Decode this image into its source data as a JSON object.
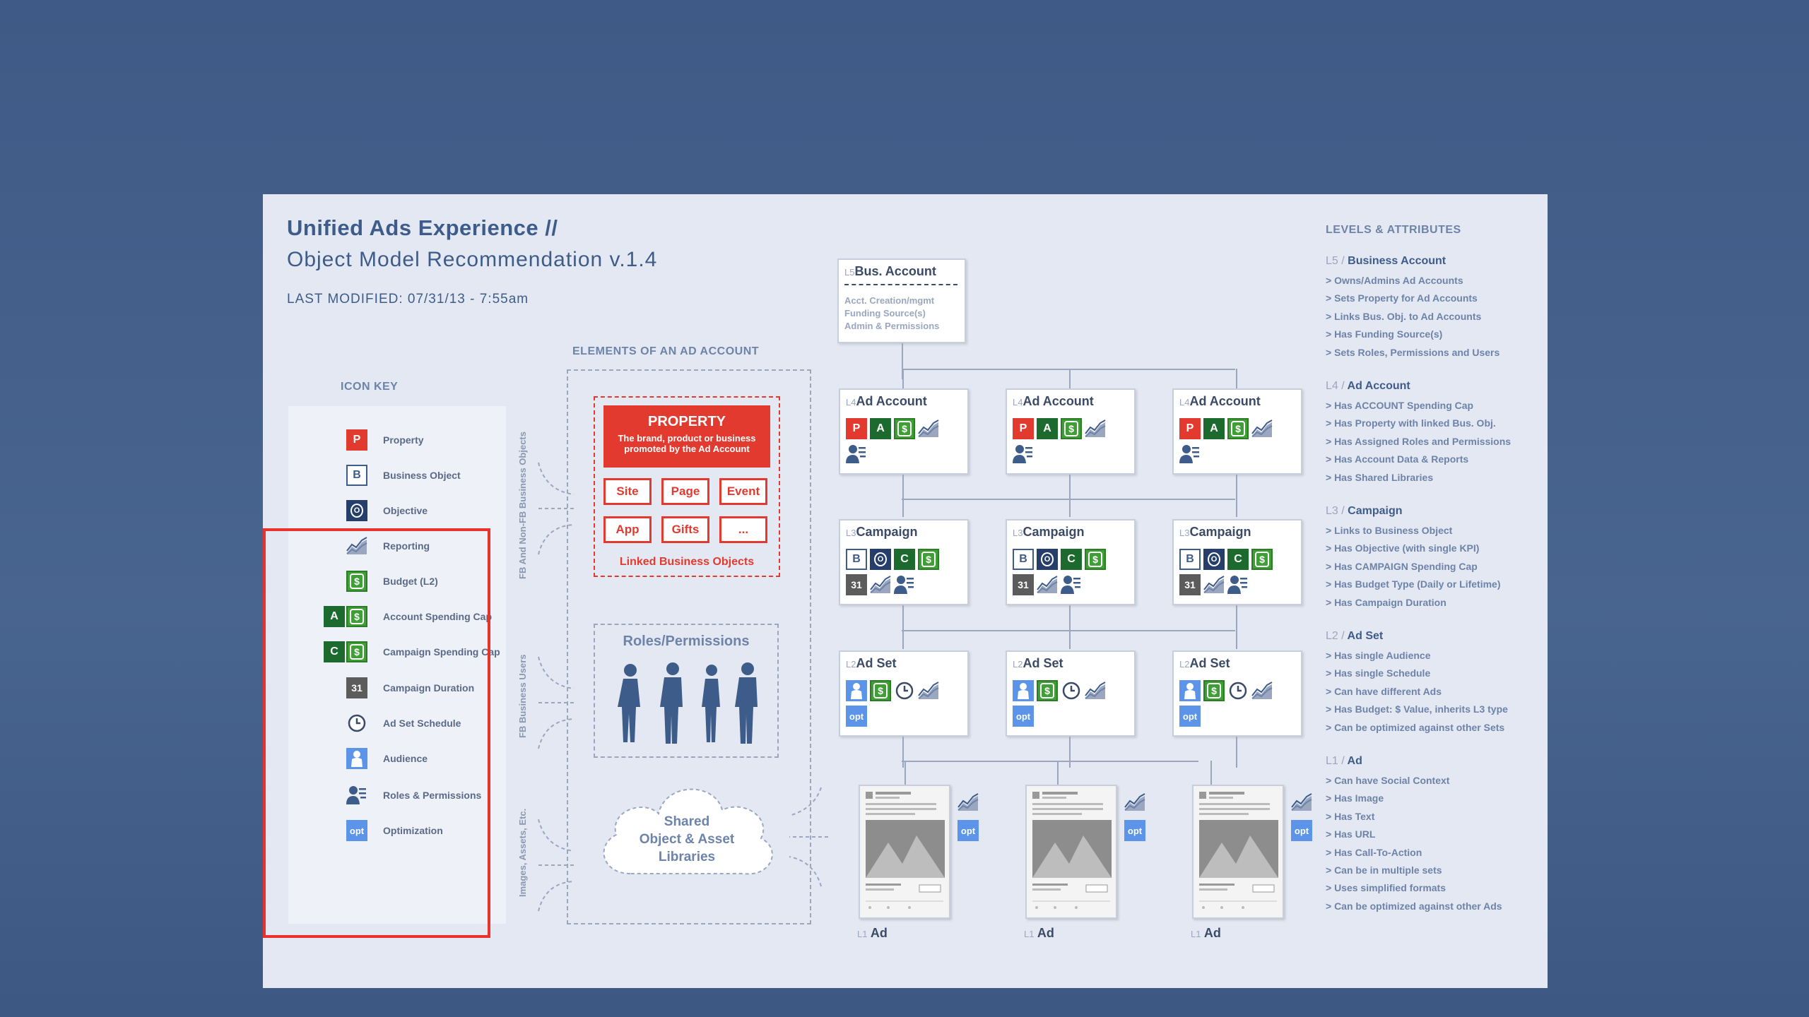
{
  "header": {
    "title": "Unified Ads Experience //",
    "subtitle": "Object Model Recommendation v.1.4",
    "modified": "LAST MODIFIED: 07/31/13 - 7:55am"
  },
  "icon_key": {
    "heading": "ICON KEY",
    "items": [
      {
        "label": "Property",
        "icons": [
          "P"
        ]
      },
      {
        "label": "Business Object",
        "icons": [
          "B"
        ]
      },
      {
        "label": "Objective",
        "icons": [
          "O"
        ]
      },
      {
        "label": "Reporting",
        "icons": [
          "reporting-icon"
        ]
      },
      {
        "label": "Budget (L2)",
        "icons": [
          "$"
        ]
      },
      {
        "label": "Account Spending Cap",
        "icons": [
          "A",
          "$"
        ]
      },
      {
        "label": "Campaign Spending Cap",
        "icons": [
          "C",
          "$"
        ]
      },
      {
        "label": "Campaign Duration",
        "icons": [
          "31"
        ]
      },
      {
        "label": "Ad Set Schedule",
        "icons": [
          "clock-icon"
        ]
      },
      {
        "label": "Audience",
        "icons": [
          "audience-icon"
        ]
      },
      {
        "label": "Roles & Permissions",
        "icons": [
          "roles-icon"
        ]
      },
      {
        "label": "Optimization",
        "icons": [
          "opt"
        ]
      }
    ]
  },
  "elements": {
    "heading": "ELEMENTS OF AN AD ACCOUNT",
    "property_title": "PROPERTY",
    "property_desc1": "The brand, product or business",
    "property_desc2": "promoted by the Ad Account",
    "buttons": [
      "Site",
      "Page",
      "Event",
      "App",
      "Gifts",
      "..."
    ],
    "linked_label": "Linked Business Objects",
    "roles_title": "Roles/Permissions",
    "library1": "Shared",
    "library2": "Object & Asset",
    "library3": "Libraries",
    "side_labels": [
      "FB And Non-FB Business Objects",
      "FB Business Users",
      "Images, Assets, Etc."
    ]
  },
  "tree": {
    "bus_account": {
      "level": "L5",
      "title": "Bus. Account",
      "lines": [
        "Acct. Creation/mgmt",
        "Funding Source(s)",
        "Admin & Permissions"
      ]
    },
    "ad_account": {
      "level": "L4",
      "title": "Ad Account"
    },
    "campaign": {
      "level": "L3",
      "title": "Campaign"
    },
    "ad_set": {
      "level": "L2",
      "title": "Ad Set"
    },
    "ad": {
      "level": "L1",
      "title": "Ad"
    },
    "opt": "opt",
    "cal": "31"
  },
  "attributes": {
    "heading": "LEVELS & ATTRIBUTES",
    "levels": [
      {
        "lv": "L5 /",
        "name": "Business Account",
        "items": [
          "> Owns/Admins Ad Accounts",
          "> Sets Property for Ad Accounts",
          "> Links Bus. Obj. to Ad Accounts",
          "> Has Funding Source(s)",
          "> Sets Roles, Permissions and Users"
        ]
      },
      {
        "lv": "L4 /",
        "name": "Ad Account",
        "items": [
          "> Has ACCOUNT Spending Cap",
          "> Has Property with linked Bus. Obj.",
          "> Has Assigned Roles and Permissions",
          "> Has Account Data & Reports",
          "> Has Shared Libraries"
        ]
      },
      {
        "lv": "L3 /",
        "name": "Campaign",
        "items": [
          "> Links to Business Object",
          "> Has Objective (with single KPI)",
          "> Has CAMPAIGN Spending Cap",
          "> Has Budget Type (Daily or Lifetime)",
          "> Has Campaign Duration"
        ]
      },
      {
        "lv": "L2 /",
        "name": "Ad Set",
        "items": [
          "> Has single Audience",
          "> Has single Schedule",
          "> Can have different Ads",
          "> Has Budget: $ Value, inherits L3 type",
          "> Can be optimized against other Sets"
        ]
      },
      {
        "lv": "L1 /",
        "name": "Ad",
        "items": [
          "> Can have Social Context",
          "> Has Image",
          "> Has Text",
          "> Has URL",
          "> Has Call-To-Action",
          "> Can be in multiple sets",
          "> Uses simplified formats",
          "> Can be optimized against other Ads"
        ]
      }
    ]
  },
  "colors": {
    "property_red": "#e23a2f",
    "dark_green": "#1d6a2f",
    "green": "#3f9e35",
    "navy": "#263f6a",
    "opt_blue": "#5b94e8",
    "highlight": "#e8322b"
  }
}
